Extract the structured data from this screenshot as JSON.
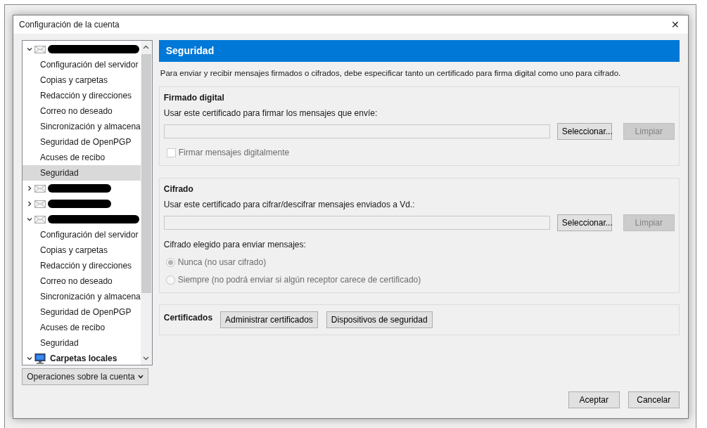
{
  "dialog": {
    "title": "Configuración de la cuenta",
    "close_glyph": "✕"
  },
  "tree": {
    "accounts": [
      {
        "kind": "redacted",
        "expanded": true,
        "children": [
          {
            "label": "Configuración del servidor",
            "selected": false
          },
          {
            "label": "Copias y carpetas",
            "selected": false
          },
          {
            "label": "Redacción y direcciones",
            "selected": false
          },
          {
            "label": "Correo no deseado",
            "selected": false
          },
          {
            "label": "Sincronización y almacena",
            "selected": false
          },
          {
            "label": "Seguridad de OpenPGP",
            "selected": false
          },
          {
            "label": "Acuses de recibo",
            "selected": false
          },
          {
            "label": "Seguridad",
            "selected": true
          }
        ]
      },
      {
        "kind": "redacted",
        "expanded": false
      },
      {
        "kind": "redacted",
        "expanded": false
      },
      {
        "kind": "redacted",
        "expanded": true,
        "children": [
          {
            "label": "Configuración del servidor",
            "selected": false
          },
          {
            "label": "Copias y carpetas",
            "selected": false
          },
          {
            "label": "Redacción y direcciones",
            "selected": false
          },
          {
            "label": "Correo no deseado",
            "selected": false
          },
          {
            "label": "Sincronización y almacena",
            "selected": false
          },
          {
            "label": "Seguridad de OpenPGP",
            "selected": false
          },
          {
            "label": "Acuses de recibo",
            "selected": false
          },
          {
            "label": "Seguridad",
            "selected": false
          }
        ]
      },
      {
        "kind": "local",
        "label": "Carpetas locales",
        "expanded": true
      }
    ],
    "account_actions": "Operaciones sobre la cuenta"
  },
  "page": {
    "heading": "Seguridad",
    "intro": "Para enviar y recibir mensajes firmados o cifrados, debe especificar tanto un certificado para firma digital como uno para cifrado.",
    "signing": {
      "title": "Firmado digital",
      "prompt": "Usar este certificado para firmar los mensajes que envíe:",
      "select": "Seleccionar...",
      "clear": "Limpiar",
      "clear_disabled": true,
      "checkbox": {
        "label": "Firmar mensajes digitalmente",
        "checked": false,
        "disabled": true
      }
    },
    "encryption": {
      "title": "Cifrado",
      "prompt": "Usar este certificado para cifrar/descifrar mensajes enviados a Vd.:",
      "select": "Seleccionar...",
      "clear": "Limpiar",
      "clear_disabled": true,
      "choice_label": "Cifrado elegido para enviar mensajes:",
      "options": [
        {
          "label": "Nunca (no usar cifrado)",
          "selected": true,
          "disabled": true
        },
        {
          "label": "Siempre (no podrá enviar si algún receptor carece de certificado)",
          "selected": false,
          "disabled": true
        }
      ]
    },
    "certificates": {
      "title": "Certificados",
      "buttons": [
        "Administrar certificados",
        "Dispositivos de seguridad"
      ]
    }
  },
  "footer": {
    "buttons": [
      "Aceptar",
      "Cancelar"
    ]
  }
}
